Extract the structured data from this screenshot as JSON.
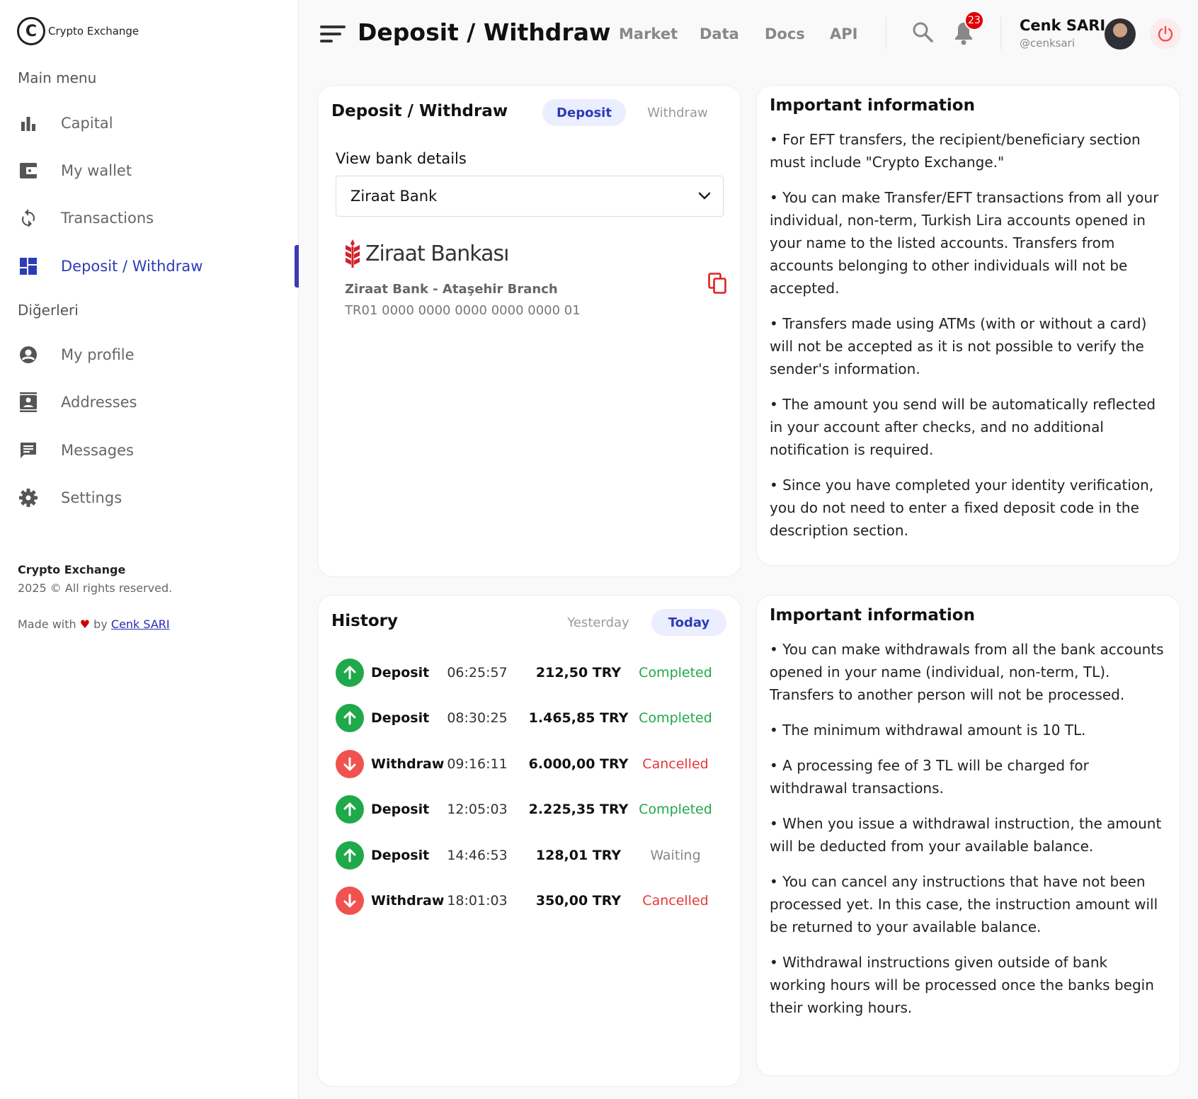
{
  "brand": {
    "logo_letter": "C",
    "name": "Crypto Exchange"
  },
  "sidebar": {
    "main_menu_title": "Main menu",
    "main_items": [
      {
        "label": "Capital",
        "icon": "bar-chart-icon"
      },
      {
        "label": "My wallet",
        "icon": "wallet-icon"
      },
      {
        "label": "Transactions",
        "icon": "sync-icon"
      },
      {
        "label": "Deposit / Withdraw",
        "icon": "dashboard-icon",
        "active": true
      }
    ],
    "other_title": "Diğerleri",
    "other_items": [
      {
        "label": "My profile",
        "icon": "account-circle-icon"
      },
      {
        "label": "Addresses",
        "icon": "contact-book-icon"
      },
      {
        "label": "Messages",
        "icon": "message-icon"
      },
      {
        "label": "Settings",
        "icon": "gear-icon"
      }
    ],
    "footer": {
      "brand": "Crypto Exchange",
      "rights": "2025 © All rights reserved.",
      "made_with": "Made with",
      "by": "by",
      "author": "Cenk SARI"
    }
  },
  "header": {
    "title": "Deposit / Withdraw",
    "nav": [
      "Market",
      "Data",
      "Docs",
      "API"
    ],
    "notification_count": "23",
    "user": {
      "name": "Cenk SARI",
      "handle": "@cenksari"
    }
  },
  "deposit_card": {
    "title": "Deposit / Withdraw",
    "tabs": {
      "deposit": "Deposit",
      "withdraw": "Withdraw",
      "active": "deposit"
    },
    "view_label": "View bank details",
    "selected_bank": "Ziraat Bank",
    "bank_logo_text": "Ziraat Bankası",
    "branch": "Ziraat Bank - Ataşehir Branch",
    "iban": "TR01 0000 0000 0000 0000 0000 01"
  },
  "info_deposit": {
    "title": "Important information",
    "items": [
      "• For EFT transfers, the recipient/beneficiary section must include \"Crypto Exchange.\"",
      "• You can make Transfer/EFT transactions from all your individual, non-term, Turkish Lira accounts opened in your name to the listed accounts. Transfers from accounts belonging to other individuals will not be accepted.",
      "• Transfers made using ATMs (with or without a card) will not be accepted as it is not possible to verify the sender's information.",
      "• The amount you send will be automatically reflected in your account after checks, and no additional notification is required.",
      "• Since you have completed your identity verification, you do not need to enter a fixed deposit code in the description section."
    ]
  },
  "history": {
    "title": "History",
    "tabs": {
      "yesterday": "Yesterday",
      "today": "Today",
      "active": "today"
    },
    "rows": [
      {
        "type": "Deposit",
        "time": "06:25:57",
        "amount": "212,50 TRY",
        "status": "Completed",
        "dir": "up"
      },
      {
        "type": "Deposit",
        "time": "08:30:25",
        "amount": "1.465,85 TRY",
        "status": "Completed",
        "dir": "up"
      },
      {
        "type": "Withdraw",
        "time": "09:16:11",
        "amount": "6.000,00 TRY",
        "status": "Cancelled",
        "dir": "down"
      },
      {
        "type": "Deposit",
        "time": "12:05:03",
        "amount": "2.225,35 TRY",
        "status": "Completed",
        "dir": "up"
      },
      {
        "type": "Deposit",
        "time": "14:46:53",
        "amount": "128,01 TRY",
        "status": "Waiting",
        "dir": "up"
      },
      {
        "type": "Withdraw",
        "time": "18:01:03",
        "amount": "350,00 TRY",
        "status": "Cancelled",
        "dir": "down"
      }
    ]
  },
  "info_withdraw": {
    "title": "Important information",
    "items": [
      "• You can make withdrawals from all the bank accounts opened in your name (individual, non-term, TL). Transfers to another person will not be processed.",
      "• The minimum withdrawal amount is 10 TL.",
      "• A processing fee of 3 TL will be charged for withdrawal transactions.",
      "• When you issue a withdrawal instruction, the amount will be deducted from your available balance.",
      "• You can cancel any instructions that have not been processed yet. In this case, the instruction amount will be returned to your available balance.",
      "• Withdrawal instructions given outside of bank working hours will be processed once the banks begin their working hours."
    ]
  },
  "colors": {
    "accent": "#2c3cb5",
    "completed": "#1fa94a",
    "cancelled": "#e53935",
    "waiting": "#888888",
    "danger": "#e10000"
  }
}
